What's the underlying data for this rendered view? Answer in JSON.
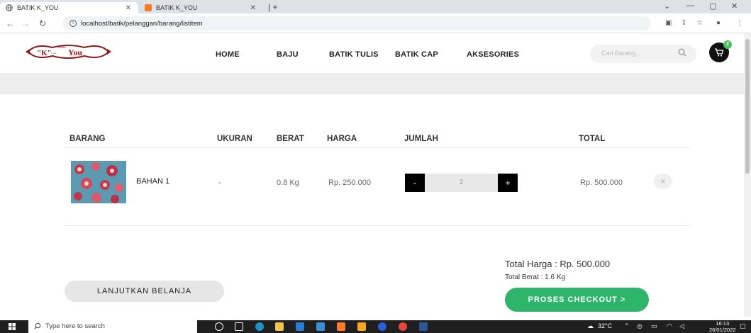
{
  "browser": {
    "tabs": [
      {
        "label": "BATIK K_YOU",
        "icon": "globe-icon"
      },
      {
        "label": "BATIK K_YOU",
        "icon": "xampp-icon"
      }
    ],
    "url": "localhost/batik/pelanggan/barang/listitem"
  },
  "header": {
    "logo_text": "K You",
    "nav": [
      "HOME",
      "BAJU",
      "BATIK TULIS",
      "BATIK CAP",
      "AKSESORIES"
    ],
    "search_placeholder": "Cari Barang...",
    "cart_count": "2",
    "accent_color": "#46c35f"
  },
  "cart": {
    "columns": [
      "BARANG",
      "UKURAN",
      "BERAT",
      "HARGA",
      "JUMLAH",
      "TOTAL"
    ],
    "items": [
      {
        "name": "BAHAN 1",
        "size": "-",
        "weight": "0.8 Kg",
        "price": "Rp. 250.000",
        "qty": "2",
        "total": "Rp. 500.000"
      }
    ],
    "qty_minus": "-",
    "qty_plus": "+",
    "remove_symbol": "×",
    "total_price": "Total Harga : Rp. 500.000",
    "total_weight": "Total Berat : 1.6 Kg",
    "continue_label": "LANJUTKAN BELANJA",
    "checkout_label": "PROSES CHECKOUT  >",
    "checkout_color": "#2fb56b"
  },
  "taskbar": {
    "search_placeholder": "Type here to search",
    "temperature": "32°C",
    "time": "16:13",
    "date": "26/01/2022"
  }
}
